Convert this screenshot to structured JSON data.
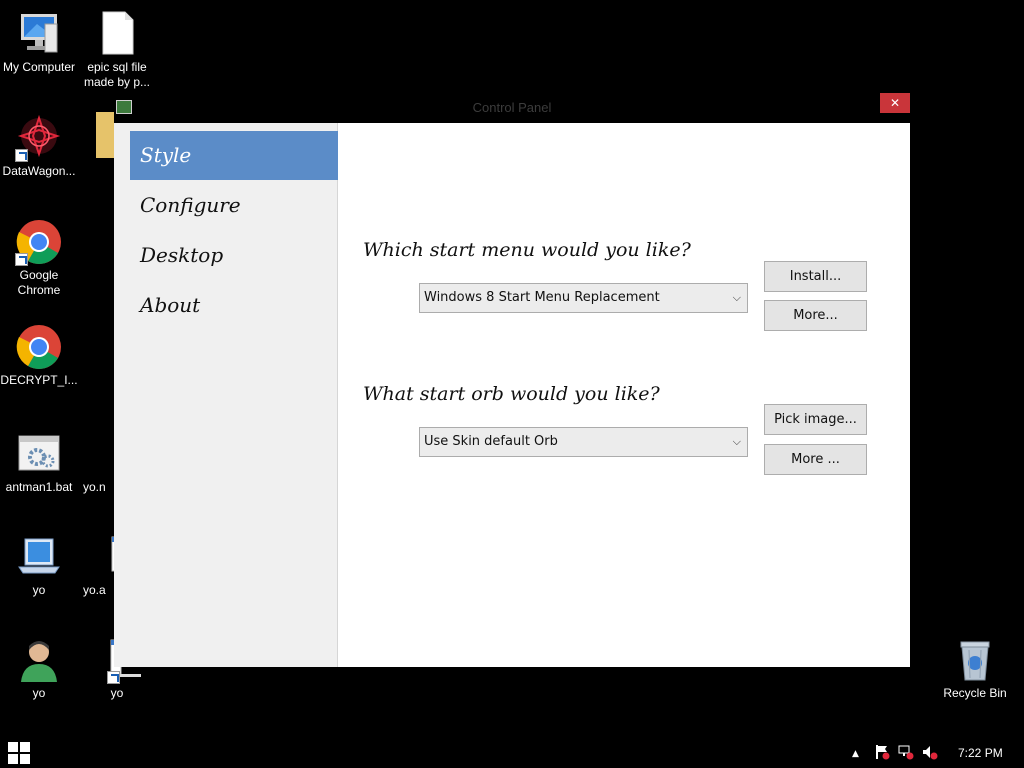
{
  "desktop": {
    "icons": [
      {
        "label": "My Computer",
        "icon": "computer-icon"
      },
      {
        "label": "epic sql file made by p...",
        "icon": "document-icon"
      },
      {
        "label": "DataWagon...",
        "icon": "datawagon-icon"
      },
      {
        "label": "Google Chrome",
        "icon": "chrome-icon"
      },
      {
        "label": "DECRYPT_I...",
        "icon": "chrome-icon"
      },
      {
        "label": "antman1.bat",
        "icon": "batch-file-icon"
      },
      {
        "label": "yo.n",
        "icon": "document-icon"
      },
      {
        "label": "yo",
        "icon": "laptop-icon"
      },
      {
        "label": "yo.a",
        "icon": "document-icon"
      },
      {
        "label": "yo",
        "icon": "user-icon"
      },
      {
        "label": "yo",
        "icon": "document-icon"
      },
      {
        "label": "Recycle Bin",
        "icon": "recycle-bin-icon"
      }
    ]
  },
  "window": {
    "title": "Control Panel",
    "close_glyph": "✕",
    "nav": [
      {
        "label": "Style",
        "selected": true
      },
      {
        "label": "Configure",
        "selected": false
      },
      {
        "label": "Desktop",
        "selected": false
      },
      {
        "label": "About",
        "selected": false
      }
    ],
    "menu_section": {
      "question": "Which start menu would you like?",
      "selected_value": "Windows 8 Start Menu Replacement",
      "install_label": "Install...",
      "more_label": "More..."
    },
    "orb_section": {
      "question": "What start orb would you like?",
      "selected_value": "Use Skin default Orb",
      "pick_image_label": "Pick image...",
      "more_label": "More ..."
    }
  },
  "taskbar": {
    "clock": "7:22 PM",
    "tray_icons": [
      "chevron-up-icon",
      "flag-icon",
      "network-icon",
      "volume-muted-icon"
    ]
  },
  "colors": {
    "nav_selected": "#5b8cc8",
    "close_button": "#c9353a",
    "desktop_background": "#000000"
  }
}
